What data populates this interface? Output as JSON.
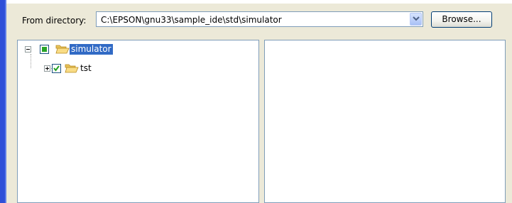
{
  "from_directory": {
    "label": "From directory:",
    "path_value": "C:\\EPSON\\gnu33\\sample_ide\\std\\simulator",
    "browse_label": "Browse..."
  },
  "tree": {
    "root": {
      "label": "simulator",
      "expanded": true,
      "check_state": "partial",
      "selected": true
    },
    "child": {
      "label": "tst",
      "expanded": false,
      "check_state": "checked"
    }
  },
  "icons": {
    "expand": "expand-plus-icon",
    "collapse": "collapse-minus-icon",
    "folder": "open-folder-icon",
    "dropdown": "chevron-down-icon"
  },
  "colors": {
    "selection": "#316ac5",
    "check_green": "#28a428",
    "window_bg": "#ece9d8",
    "border": "#7f9db9"
  }
}
